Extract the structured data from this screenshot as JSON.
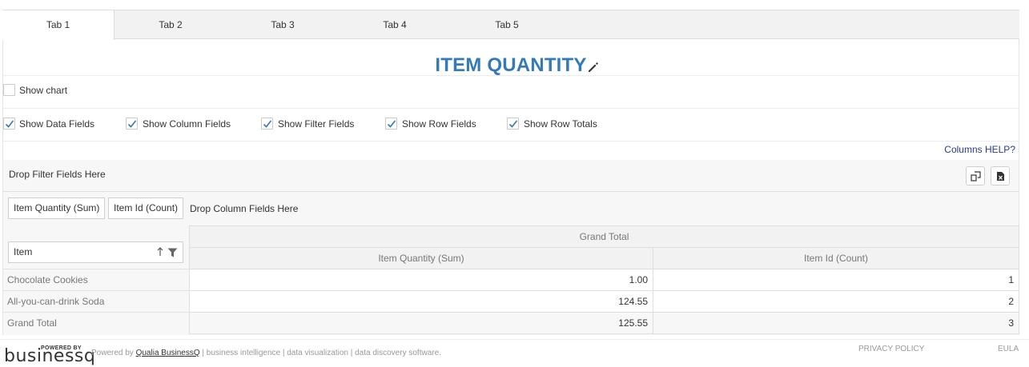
{
  "tabs": [
    {
      "label": "Tab 1",
      "active": true
    },
    {
      "label": "Tab 2",
      "active": false
    },
    {
      "label": "Tab 3",
      "active": false
    },
    {
      "label": "Tab 4",
      "active": false
    },
    {
      "label": "Tab 5",
      "active": false
    }
  ],
  "title": "ITEM QUANTITY",
  "options": {
    "show_chart": {
      "label": "Show chart",
      "checked": false
    },
    "show_data_fields": {
      "label": "Show Data Fields",
      "checked": true
    },
    "show_column_fields": {
      "label": "Show Column Fields",
      "checked": true
    },
    "show_filter_fields": {
      "label": "Show Filter Fields",
      "checked": true
    },
    "show_row_fields": {
      "label": "Show Row Fields",
      "checked": true
    },
    "show_row_totals": {
      "label": "Show Row Totals",
      "checked": true
    }
  },
  "help_link": "Columns HELP?",
  "pivot": {
    "filter_drop": "Drop Filter Fields Here",
    "data_fields": [
      "Item Quantity (Sum)",
      "Item Id (Count)"
    ],
    "column_drop": "Drop Column Fields Here",
    "row_field": "Item",
    "grand_total_header": "Grand Total",
    "column_headers": [
      "Item Quantity (Sum)",
      "Item Id (Count)"
    ],
    "rows": [
      {
        "label": "Chocolate Cookies",
        "values": [
          "1.00",
          "1"
        ]
      },
      {
        "label": "All-you-can-drink Soda",
        "values": [
          "124.55",
          "2"
        ]
      }
    ],
    "total_row": {
      "label": "Grand Total",
      "values": [
        "125.55",
        "3"
      ]
    }
  },
  "footer": {
    "logo_powered": "POWERED BY",
    "logo_name": "businessq",
    "powered_prefix": "Powered by ",
    "powered_link": "Qualia BusinessQ",
    "powered_suffix": " | business intelligence | data visualization | data discovery software.",
    "privacy": "PRIVACY POLICY",
    "eula": "EULA"
  },
  "colors": {
    "title": "#337ab7",
    "help": "#2a3a93",
    "check": "#337ab7"
  }
}
